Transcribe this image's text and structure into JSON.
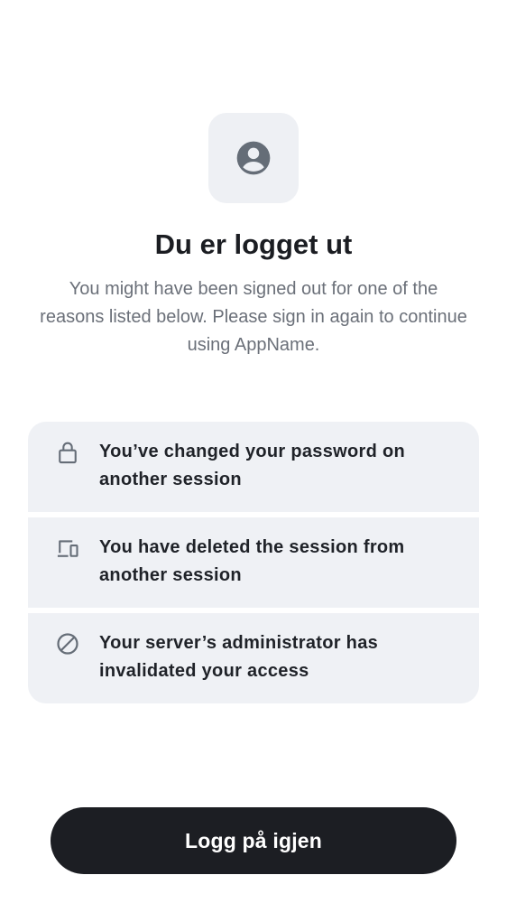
{
  "header": {
    "icon": "user-avatar-icon",
    "title": "Du er logget ut",
    "subtitle": "You might have been signed out for one of the reasons listed below. Please sign in again to continue using AppName."
  },
  "reasons": [
    {
      "icon": "lock-icon",
      "text": "You’ve changed your password on another session"
    },
    {
      "icon": "devices-icon",
      "text": "You have deleted the session from another session"
    },
    {
      "icon": "block-icon",
      "text": "Your server’s administrator has invalidated your access"
    }
  ],
  "actions": {
    "sign_in_again_label": "Logg på igjen"
  },
  "colors": {
    "primary_button": "#1c1e23",
    "card_background": "#eff1f5",
    "icon_box_background": "#eef0f4",
    "icon_gray": "#656d77",
    "subtitle_gray": "#6b7079"
  }
}
